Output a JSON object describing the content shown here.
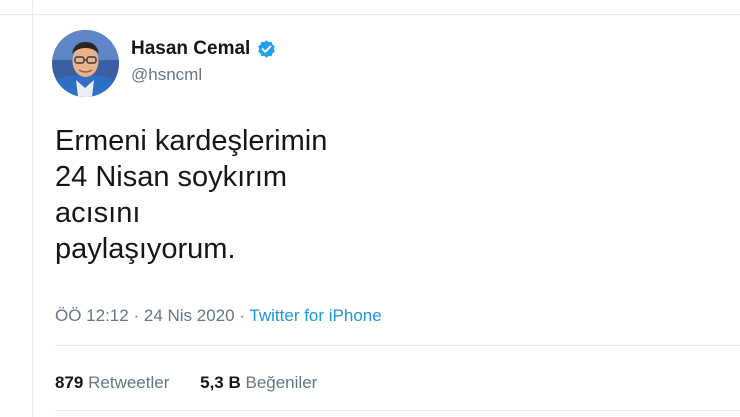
{
  "author": {
    "display_name": "Hasan Cemal",
    "handle": "@hsncml",
    "verified": true,
    "avatar": "profile-photo"
  },
  "tweet": {
    "lines": [
      "Ermeni kardeşlerimin",
      "24 Nisan soykırım",
      "acısını",
      "paylaşıyorum."
    ]
  },
  "meta": {
    "time": "ÖÖ 12:12",
    "separator_1": "·",
    "date": "24 Nis 2020",
    "separator_2": "·",
    "source": "Twitter for iPhone"
  },
  "stats": {
    "retweets_count": "879",
    "retweets_label": "Retweetler",
    "likes_count": "5,3 B",
    "likes_label": "Beğeniler"
  },
  "colors": {
    "text": "#14171a",
    "secondary": "#657786",
    "link": "#1b95e0",
    "verified": "#1da1f2",
    "divider": "#e6ecf0"
  }
}
